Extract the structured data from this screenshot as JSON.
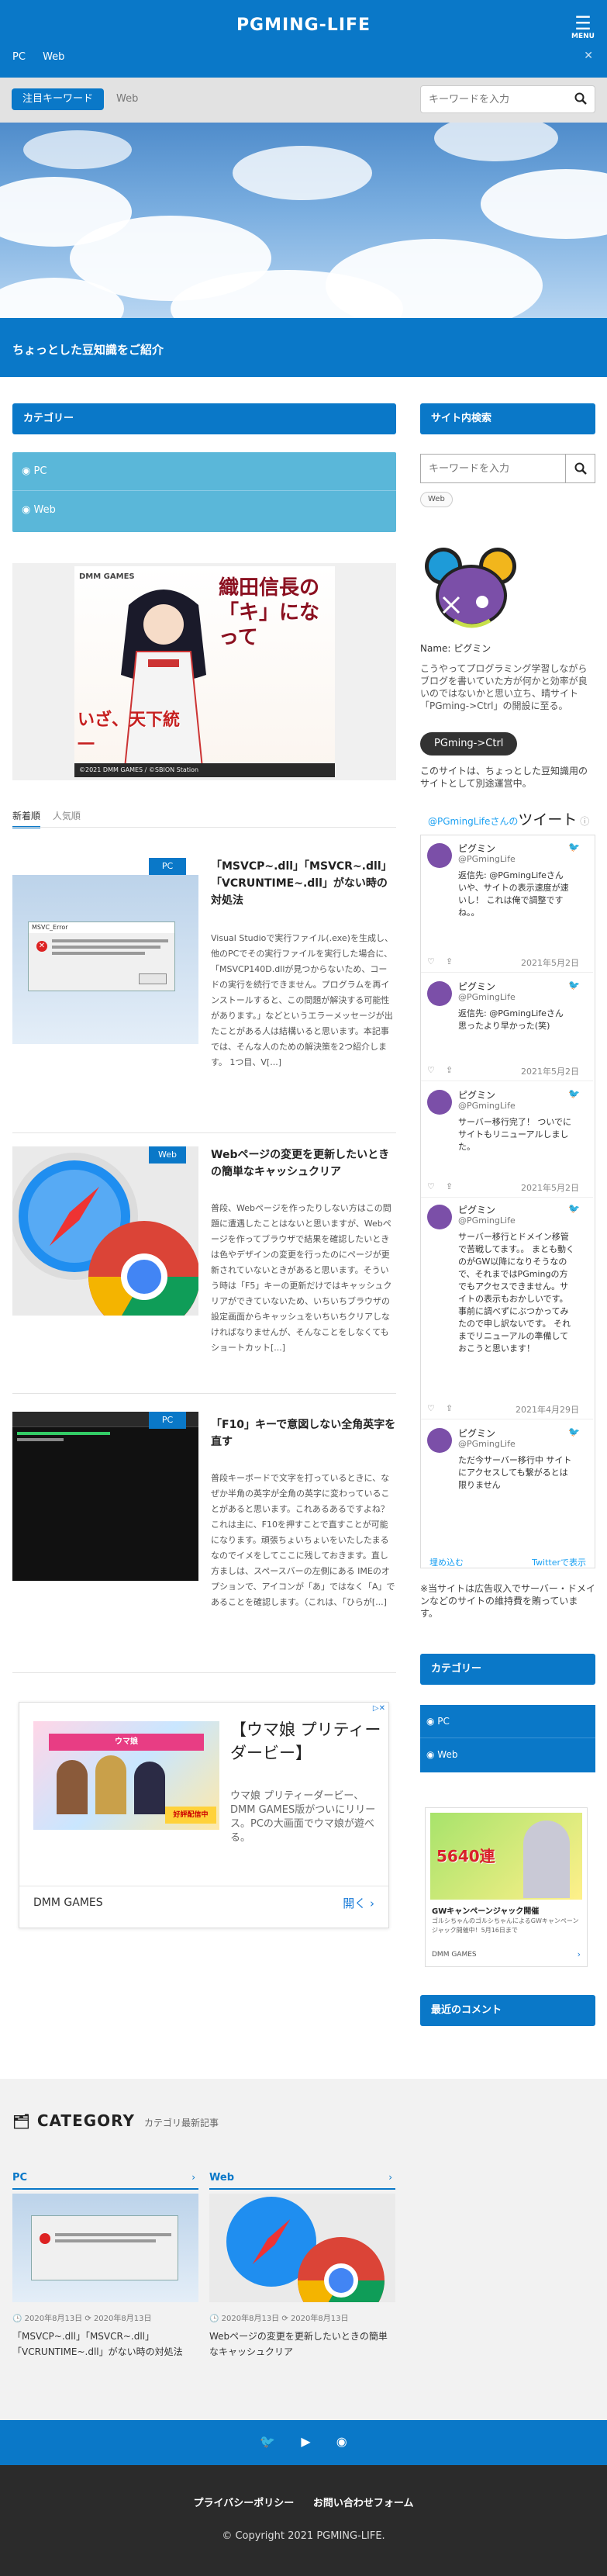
{
  "header": {
    "logo": "PGMING-LIFE",
    "menu_label": "MENU",
    "nav": [
      "PC",
      "Web"
    ]
  },
  "keyword_bar": {
    "button": "注目キーワード",
    "tag": "Web",
    "search_placeholder": "キーワードを入力"
  },
  "hero": {
    "caption": "ちょっとした豆知識をご紹介"
  },
  "main": {
    "category_title": "カテゴリー",
    "categories": [
      "PC",
      "Web"
    ],
    "ad": {
      "brand": "DMM GAMES",
      "headline": "織田信長の「キ」になって",
      "sub": "いざ、天下統一",
      "footer": "©2021 DMM GAMES / ©SBION Station"
    },
    "tabs": [
      "新着順",
      "人気順"
    ],
    "posts": [
      {
        "category": "PC",
        "title": "「MSVCP~.dll」「MSVCR~.dll」「VCRUNTIME~.dll」がない時の対処法",
        "excerpt": "Visual Studioで実行ファイル(.exe)を生成し、他のPCでその実行ファイルを実行した場合に、「MSVCP140D.dllが見つからないため、コードの実行を続行できません。プログラムを再インストールすると、この問題が解決する可能性があります。」などというエラーメッセージが出たことがある人は結構いると思います。本記事では、そんな人のための解決策を2つ紹介します。 1つ目、V[...]"
      },
      {
        "category": "Web",
        "title": "Webページの変更を更新したいときの簡単なキャッシュクリア",
        "excerpt": "普段、Webページを作ったりしない方はこの問題に遭遇したことはないと思いますが、Webページを作ってブラウザで結果を確認したいときは色やデザインの変更を行ったのにページが更新されていないときがあると思います。そういう時は「F5」キーの更新だけではキャッシュクリアができていないため、いちいちブラウザの設定画面からキャッシュをいちいちクリアしなければなりませんが、そんなことをしなくてもショートカット[...]"
      },
      {
        "category": "PC",
        "title": "「F10」キーで意図しない全角英字を直す",
        "excerpt": "普段キーボードで文字を打っているときに、なぜか半角の英字が全角の英字に変わっていることがあると思います。これあるあるですよね？これは主に、F10を押すことで直すことが可能になります。頑張ちょいちょいをいたしたまるなのでイメをしてここに残しておきます。直し方ましは、スペースバーの左側にある IMEのオプションで、アイコンが「あ」ではなく「A」であることを確認します。（これは、「ひらが[...]"
      }
    ],
    "ad2": {
      "title": "【ウマ娘 プリティーダービー】",
      "body": "ウマ娘 プリティーダービー、DMM GAMES版がついにリリース。PCの大画面でウマ娘が遊べる。",
      "publisher": "DMM GAMES",
      "cta": "開く"
    }
  },
  "sidebar": {
    "search_title": "サイト内検索",
    "search_placeholder": "キーワードを入力",
    "tag": "Web",
    "profile_name": "Name: ピグミン",
    "profile_desc": "こうやってプログラミング学習しながらブログを書いていた方が何かと効率が良いのではないかと思い立ち、晴サイト「PGming->Ctrl」の開設に至る。",
    "profile_button": "PGming->Ctrl",
    "profile_note": "このサイトは、ちょっとした豆知識用のサイトとして別途運営中。",
    "twitter_head_handle": "@PGmingLifeさんの",
    "twitter_head_word": "ツイート",
    "tweets": [
      {
        "name": "ピグミン",
        "handle": "@PGmingLife",
        "text": "返信先: @PGmingLifeさん いや、サイトの表示速度が速いし！ これは俺で調整ですね。。",
        "date": "2021年5月2日"
      },
      {
        "name": "ピグミン",
        "handle": "@PGmingLife",
        "text": "返信先: @PGmingLifeさん 思ったより早かった(笑)",
        "date": "2021年5月2日"
      },
      {
        "name": "ピグミン",
        "handle": "@PGmingLife",
        "text": "サーバー移行完了！ ついでにサイトもリニューアルしました。",
        "date": "2021年5月2日"
      },
      {
        "name": "ピグミン",
        "handle": "@PGmingLife",
        "text": "サーバー移行とドメイン移管で苦戦してます。。 まとも動くのがGW以降になりそうなので、それまではPGmingの方でもアクセスできません。サイトの表示もおかしいです。 事前に調べずにぶつかってみたので申し訳ないです。 それまでリニューアルの準備しておこうと思います！",
        "date": "2021年4月29日"
      },
      {
        "name": "ピグミン",
        "handle": "@PGmingLife",
        "text": "ただ今サーバー移行中 サイトにアクセスしても繋がるとは限りません",
        "date": ""
      }
    ],
    "twitter_embed": "埋め込む",
    "twitter_view": "Twitterで表示",
    "ad_note": "※当サイトは広告収入でサーバー・ドメインなどのサイトの維持費を賄っています。",
    "category_title": "カテゴリー",
    "categories": [
      "PC",
      "Web"
    ],
    "ad3": {
      "title": "GWキャンペーンジャック開催",
      "body": "ゴルシちゃんのゴルシちゃんによるGWキャンペーンジャック開催中！5月16日まで",
      "publisher": "DMM GAMES",
      "promo": "5640連"
    },
    "recent_comments_title": "最近のコメント"
  },
  "category_section": {
    "title": "CATEGORY",
    "subtitle": "カテゴリ最新記事",
    "columns": [
      {
        "name": "PC",
        "date1": "2020年8月13日",
        "date2": "2020年8月13日",
        "title": "「MSVCP~.dll」「MSVCR~.dll」「VCRUNTIME~.dll」がない時の対処法"
      },
      {
        "name": "Web",
        "date1": "2020年8月13日",
        "date2": "2020年8月13日",
        "title": "Webページの変更を更新したいときの簡単なキャッシュクリア"
      }
    ]
  },
  "footer": {
    "links": [
      "プライバシーポリシー",
      "お問い合わせフォーム"
    ],
    "copyright": "© Copyright 2021 PGMING-LIFE."
  },
  "colors": {
    "accent": "#0a78c8",
    "category_box": "#5ab7d9",
    "footer_dark": "#2b2b2b"
  }
}
